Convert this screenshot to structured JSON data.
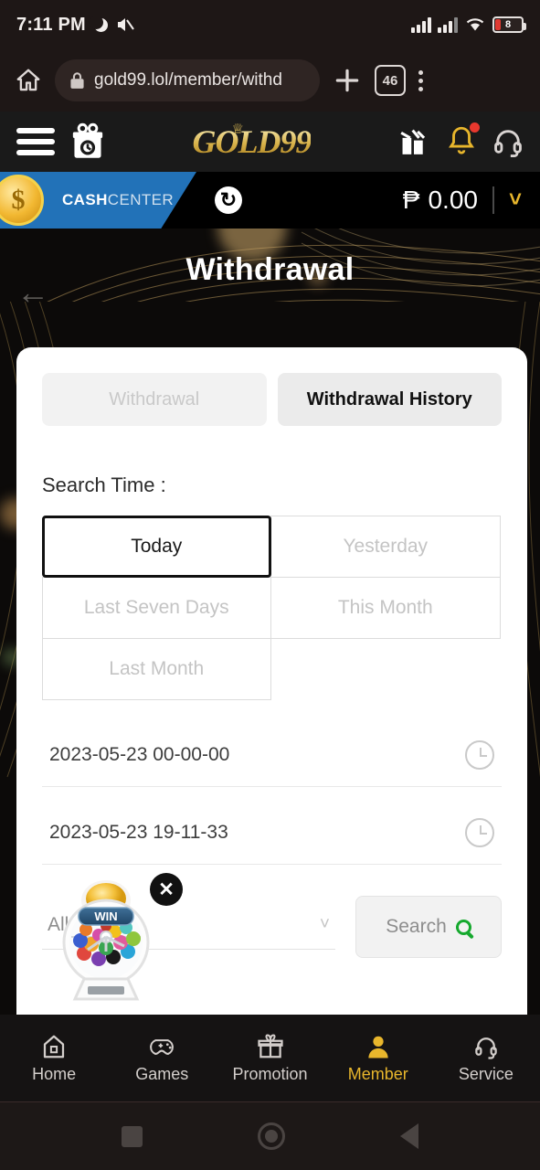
{
  "statusbar": {
    "time": "7:11 PM",
    "battery_level": "8",
    "icons": [
      "moon-icon",
      "mute-icon",
      "signal-icon",
      "signal-icon",
      "wifi-icon",
      "battery-icon"
    ]
  },
  "browser": {
    "url": "gold99.lol/member/withd",
    "tab_count": "46",
    "home_icon": "home-icon",
    "lock_icon": "lock-icon",
    "new_tab_icon": "plus-icon",
    "menu_icon": "kebab-menu-icon"
  },
  "site_header": {
    "logo": "GOLD99",
    "crown_icon": "crown-icon",
    "menu_icon": "hamburger-icon",
    "gift_box_icon": "gift-box-icon",
    "gifts_icon": "gifts-icon",
    "bell_icon": "bell-icon",
    "headset_icon": "headset-icon"
  },
  "cash_center": {
    "label_bold": "CASH",
    "label_light": "CENTER",
    "coin_symbol": "$",
    "refresh_icon": "refresh-icon",
    "currency": "₱",
    "balance": "0.00",
    "chevron_icon": "chevron-down-icon",
    "accent_blue": "#2272b8",
    "accent_gold": "#e8b62c"
  },
  "hero": {
    "title": "Withdrawal",
    "back_icon": "back-arrow-icon"
  },
  "tabs": [
    {
      "label": "Withdrawal",
      "active": false
    },
    {
      "label": "Withdrawal History",
      "active": true
    }
  ],
  "search_time": {
    "label": "Search Time :",
    "options": [
      {
        "label": "Today",
        "selected": true
      },
      {
        "label": "Yesterday",
        "selected": false
      },
      {
        "label": "Last Seven Days",
        "selected": false
      },
      {
        "label": "This Month",
        "selected": false
      },
      {
        "label": "Last Month",
        "selected": false
      }
    ]
  },
  "date_rows": [
    {
      "value": "2023-05-23 00-00-00",
      "icon": "clock-icon"
    },
    {
      "value": "2023-05-23 19-11-33",
      "icon": "clock-icon"
    }
  ],
  "filter": {
    "selected_value": "All",
    "chevron_icon": "chevron-down-icon"
  },
  "search_button": {
    "label": "Search",
    "icon": "search-icon",
    "icon_color": "#16a92e"
  },
  "float_widget": {
    "banner_text": "WIN",
    "close_icon": "close-icon",
    "name": "lottery-machine-widget"
  },
  "bottom_nav": [
    {
      "label": "Home",
      "icon": "home-icon",
      "active": false
    },
    {
      "label": "Games",
      "icon": "gamepad-icon",
      "active": false
    },
    {
      "label": "Promotion",
      "icon": "gift-icon",
      "active": false
    },
    {
      "label": "Member",
      "icon": "user-icon",
      "active": true
    },
    {
      "label": "Service",
      "icon": "headset-icon",
      "active": false
    }
  ],
  "android_nav": {
    "recents_icon": "square-icon",
    "home_icon": "circle-icon",
    "back_icon": "triangle-back-icon"
  }
}
